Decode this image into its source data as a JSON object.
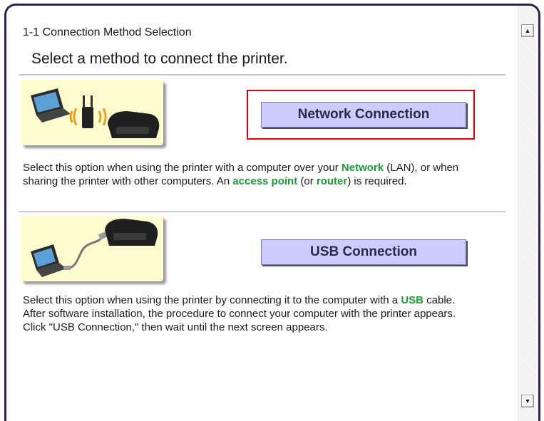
{
  "section_title": "1-1 Connection Method Selection",
  "heading": "Select a method to connect the printer.",
  "options": {
    "network": {
      "button_label": "Network Connection",
      "desc": {
        "p1": "Select this option when using the printer with a computer over your ",
        "kw1": "Network",
        "p2": " (LAN), or when sharing the printer with other computers. An ",
        "kw2": "access point",
        "p3": " (or ",
        "kw3": "router",
        "p4": ") is required."
      }
    },
    "usb": {
      "button_label": "USB Connection",
      "desc": {
        "p1": "Select this option when using the printer by connecting it to the computer with a ",
        "kw1": "USB",
        "p2": " cable. After software installation, the procedure to connect your computer with the printer appears. Click \"USB Connection,\" then wait until the next screen appears."
      }
    }
  },
  "scrollbar": {
    "up_icon": "▲",
    "down_icon": "▼"
  },
  "colors": {
    "keyword": "#1d9a3a",
    "button_bg": "#ccccff",
    "highlight": "#e00000",
    "illustration_bg": "#fffcd0"
  }
}
